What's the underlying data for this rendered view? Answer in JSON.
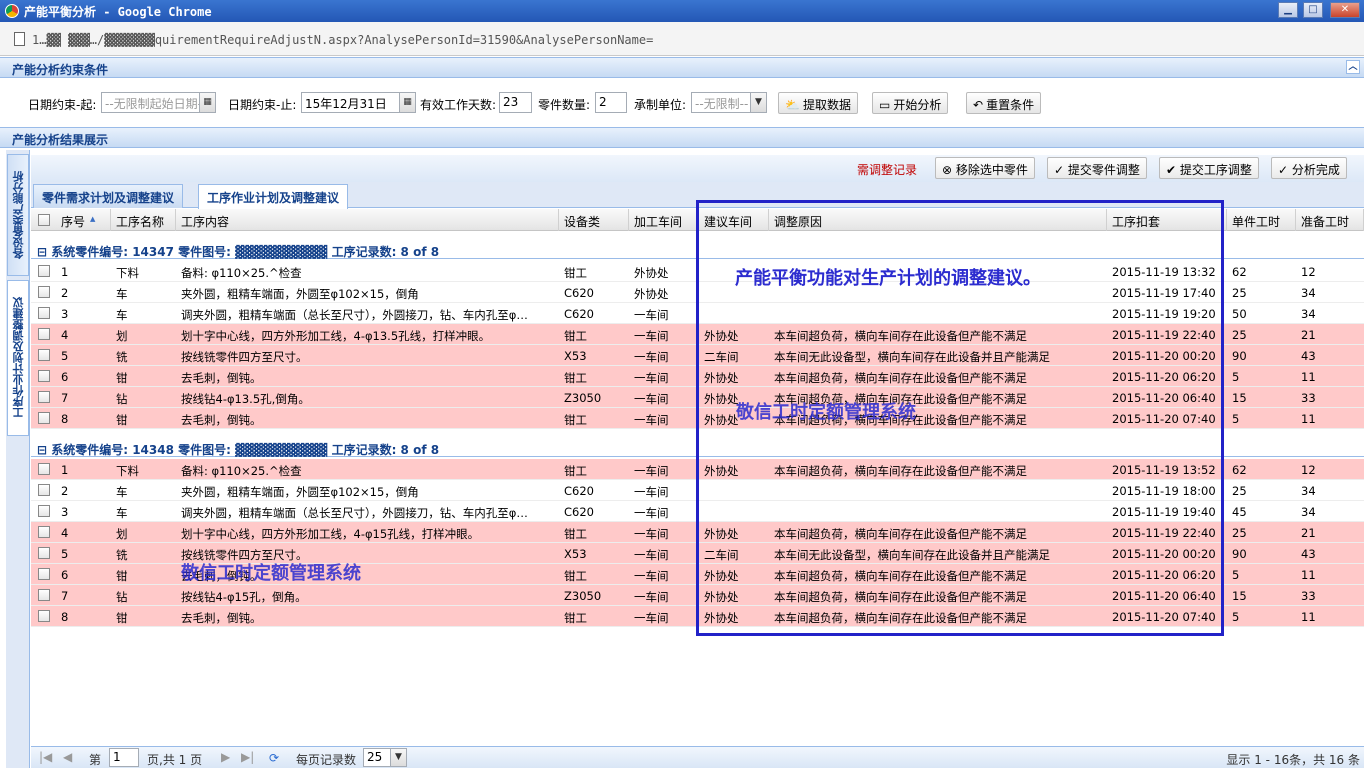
{
  "window": {
    "title": "产能平衡分析 - Google Chrome",
    "min": "▁",
    "max": "□",
    "close": "✕"
  },
  "address": {
    "url": "1…▓▓ ▓▓▓…/▓▓▓▓▓▓▓quirementRequireAdjustN.aspx?AnalysePersonId=31590&AnalysePersonName="
  },
  "constraints": {
    "header": "产能分析约束条件",
    "date_from_label": "日期约束-起:",
    "date_from_placeholder": "--无限制起始日期--",
    "date_to_label": "日期约束-止:",
    "date_to_value": "15年12月31日",
    "workdays_label": "有效工作天数:",
    "workdays_value": "23",
    "parts_label": "零件数量:",
    "parts_value": "2",
    "unit_label": "承制单位:",
    "unit_placeholder": "--无限制--",
    "fetch_button": "提取数据",
    "analyze_button": "开始分析",
    "reset_button": "重置条件"
  },
  "results": {
    "header": "产能分析结果展示"
  },
  "side_tabs": [
    "各设备类产能分析",
    "工序作业计划及调整建议"
  ],
  "toolbar": {
    "record_label": "需调整记录",
    "remove_button": "移除选中零件",
    "submit_parts_button": "提交零件调整",
    "submit_process_button": "提交工序调整",
    "finish_button": "分析完成"
  },
  "tabs": [
    "零件需求计划及调整建议",
    "工序作业计划及调整建议"
  ],
  "columns": [
    "序号",
    "工序名称",
    "工序内容",
    "设备类",
    "加工车间",
    "建议车间",
    "调整原因",
    "工序扣套",
    "单件工时",
    "准备工时"
  ],
  "groups": [
    {
      "header": "⊟ 系统零件编号: 14347    零件图号: ▓▓▓▓▓▓▓▓▓▓    工序记录数: 8 of 8",
      "rows": [
        {
          "no": "1",
          "name": "下料",
          "content": "备料: φ110×25.^检查",
          "equip": "钳工",
          "shop": "外协处",
          "sug": "",
          "reason": "",
          "time": "2015-11-19 13:32",
          "unit": "62",
          "prep": "12",
          "hl": false
        },
        {
          "no": "2",
          "name": "车",
          "content": "夹外圆，粗精车端面，外圆至φ102×15，倒角",
          "equip": "C620",
          "shop": "外协处",
          "sug": "",
          "reason": "",
          "time": "2015-11-19 17:40",
          "unit": "25",
          "prep": "34",
          "hl": false
        },
        {
          "no": "3",
          "name": "车",
          "content": "调夹外圆，粗精车端面（总长至尺寸），外圆接刀，钻、车内孔至φ…",
          "equip": "C620",
          "shop": "一车间",
          "sug": "",
          "reason": "",
          "time": "2015-11-19 19:20",
          "unit": "50",
          "prep": "34",
          "hl": false
        },
        {
          "no": "4",
          "name": "划",
          "content": "划十字中心线，四方外形加工线，4-φ13.5孔线，打样冲眼。",
          "equip": "钳工",
          "shop": "一车间",
          "sug": "外协处",
          "reason": "本车间超负荷，横向车间存在此设备但产能不满足",
          "time": "2015-11-19 22:40",
          "unit": "25",
          "prep": "21",
          "hl": true
        },
        {
          "no": "5",
          "name": "铣",
          "content": "按线铣零件四方至尺寸。",
          "equip": "X53",
          "shop": "一车间",
          "sug": "二车间",
          "reason": "本车间无此设备型，横向车间存在此设备并且产能满足",
          "time": "2015-11-20 00:20",
          "unit": "90",
          "prep": "43",
          "hl": true
        },
        {
          "no": "6",
          "name": "钳",
          "content": "去毛刺，倒钝。",
          "equip": "钳工",
          "shop": "一车间",
          "sug": "外协处",
          "reason": "本车间超负荷，横向车间存在此设备但产能不满足",
          "time": "2015-11-20 06:20",
          "unit": "5",
          "prep": "11",
          "hl": true
        },
        {
          "no": "7",
          "name": "钻",
          "content": "按线钻4-φ13.5孔,倒角。",
          "equip": "Z3050",
          "shop": "一车间",
          "sug": "外协处",
          "reason": "本车间超负荷，横向车间存在此设备但产能不满足",
          "time": "2015-11-20 06:40",
          "unit": "15",
          "prep": "33",
          "hl": true
        },
        {
          "no": "8",
          "name": "钳",
          "content": "去毛刺，倒钝。",
          "equip": "钳工",
          "shop": "一车间",
          "sug": "外协处",
          "reason": "本车间超负荷，横向车间存在此设备但产能不满足",
          "time": "2015-11-20 07:40",
          "unit": "5",
          "prep": "11",
          "hl": true
        }
      ]
    },
    {
      "header": "⊟ 系统零件编号: 14348    零件图号: ▓▓▓▓▓▓▓▓▓▓    工序记录数: 8 of 8",
      "rows": [
        {
          "no": "1",
          "name": "下料",
          "content": "备料: φ110×25.^检查",
          "equip": "钳工",
          "shop": "一车间",
          "sug": "外协处",
          "reason": "本车间超负荷，横向车间存在此设备但产能不满足",
          "time": "2015-11-19 13:52",
          "unit": "62",
          "prep": "12",
          "hl": true
        },
        {
          "no": "2",
          "name": "车",
          "content": "夹外圆，粗精车端面，外圆至φ102×15，倒角",
          "equip": "C620",
          "shop": "一车间",
          "sug": "",
          "reason": "",
          "time": "2015-11-19 18:00",
          "unit": "25",
          "prep": "34",
          "hl": false
        },
        {
          "no": "3",
          "name": "车",
          "content": "调夹外圆，粗精车端面（总长至尺寸），外圆接刀，钻、车内孔至φ…",
          "equip": "C620",
          "shop": "一车间",
          "sug": "",
          "reason": "",
          "time": "2015-11-19 19:40",
          "unit": "45",
          "prep": "34",
          "hl": false
        },
        {
          "no": "4",
          "name": "划",
          "content": "划十字中心线，四方外形加工线，4-φ15孔线，打样冲眼。",
          "equip": "钳工",
          "shop": "一车间",
          "sug": "外协处",
          "reason": "本车间超负荷，横向车间存在此设备但产能不满足",
          "time": "2015-11-19 22:40",
          "unit": "25",
          "prep": "21",
          "hl": true
        },
        {
          "no": "5",
          "name": "铣",
          "content": "按线铣零件四方至尺寸。",
          "equip": "X53",
          "shop": "一车间",
          "sug": "二车间",
          "reason": "本车间无此设备型，横向车间存在此设备并且产能满足",
          "time": "2015-11-20 00:20",
          "unit": "90",
          "prep": "43",
          "hl": true
        },
        {
          "no": "6",
          "name": "钳",
          "content": "去毛刺，倒钝。",
          "equip": "钳工",
          "shop": "一车间",
          "sug": "外协处",
          "reason": "本车间超负荷，横向车间存在此设备但产能不满足",
          "time": "2015-11-20 06:20",
          "unit": "5",
          "prep": "11",
          "hl": true
        },
        {
          "no": "7",
          "name": "钻",
          "content": "按线钻4-φ15孔，倒角。",
          "equip": "Z3050",
          "shop": "一车间",
          "sug": "外协处",
          "reason": "本车间超负荷，横向车间存在此设备但产能不满足",
          "time": "2015-11-20 06:40",
          "unit": "15",
          "prep": "33",
          "hl": true
        },
        {
          "no": "8",
          "name": "钳",
          "content": "去毛刺，倒钝。",
          "equip": "钳工",
          "shop": "一车间",
          "sug": "外协处",
          "reason": "本车间超负荷，横向车间存在此设备但产能不满足",
          "time": "2015-11-20 07:40",
          "unit": "5",
          "prep": "11",
          "hl": true
        }
      ]
    }
  ],
  "pager": {
    "page_label": "第",
    "page_value": "1",
    "page_total": "页,共 1 页",
    "per_page_label": "每页记录数",
    "per_page_value": "25",
    "summary": "显示 1 - 16条，共 16 条"
  },
  "annotations": {
    "callout": "产能平衡功能对生产计划的调整建议。",
    "watermark1": "敬信工时定额管理系统",
    "watermark2": "敬信工时定额管理系统",
    "box_color": "#2222c8"
  }
}
